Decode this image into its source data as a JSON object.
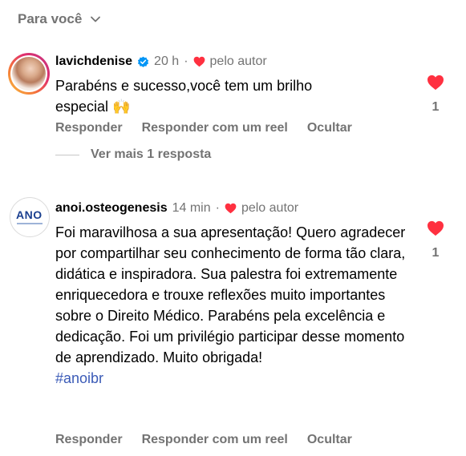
{
  "filter": {
    "label": "Para você"
  },
  "comments": [
    {
      "username": "lavichdenise",
      "verified": true,
      "time": "20 h",
      "separator": "·",
      "liked_by_author": "pelo autor",
      "text": "Parabéns e sucesso,você tem um brilho especial 🙌",
      "like_count": "1",
      "actions": [
        "Responder",
        "Responder com um reel",
        "Ocultar"
      ],
      "more_replies": "Ver mais 1 resposta"
    },
    {
      "username": "anoi.osteogenesis",
      "verified": false,
      "time": "14 min",
      "separator": "·",
      "liked_by_author": "pelo autor",
      "text": "Foi maravilhosa a sua apresentação! Quero agradecer por compartilhar seu conhecimento de forma tão clara, didática e inspiradora. Sua palestra foi extremamente enriquecedora e trouxe reflexões muito importantes sobre o Direito Médico. Parabéns pela excelência e dedicação. Foi um privilégio participar desse momento de aprendizado. Muito obrigada!",
      "hashtag": "#anoibr",
      "like_count": "1",
      "actions": [
        "Responder",
        "Responder com um reel",
        "Ocultar"
      ],
      "avatar_text": "ANO"
    }
  ],
  "colors": {
    "secondary_text": "#737373",
    "heart": "#ff3040",
    "verified": "#0095f6",
    "hashtag": "#3b5bb7"
  }
}
